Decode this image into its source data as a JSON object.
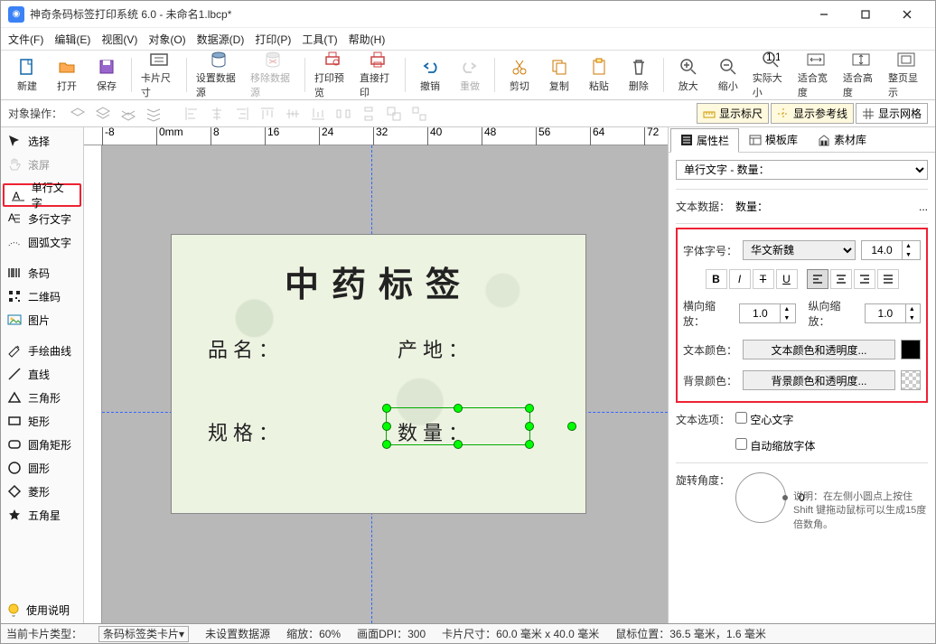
{
  "title": "神奇条码标签打印系统 6.0 - 未命名1.lbcp*",
  "menu": [
    "文件(F)",
    "编辑(E)",
    "视图(V)",
    "对象(O)",
    "数据源(D)",
    "打印(P)",
    "工具(T)",
    "帮助(H)"
  ],
  "toolbar": {
    "new": "新建",
    "open": "打开",
    "save": "保存",
    "cardsize": "卡片尺寸",
    "setds": "设置数据源",
    "remds": "移除数据源",
    "preview": "打印预览",
    "print": "直接打印",
    "undo": "撤销",
    "redo": "重做",
    "cut": "剪切",
    "copy": "复制",
    "paste": "粘贴",
    "delete": "删除",
    "zoomin": "放大",
    "zoomout": "缩小",
    "actual": "实际大小",
    "fitw": "适合宽度",
    "fith": "适合高度",
    "fitpage": "整页显示"
  },
  "objbar": {
    "label": "对象操作：",
    "ruler": "显示标尺",
    "guides": "显示参考线",
    "grid": "显示网格"
  },
  "lefttools": {
    "select": "选择",
    "pan": "滚屏",
    "singletext": "单行文字",
    "multitext": "多行文字",
    "arctext": "圆弧文字",
    "barcode": "条码",
    "qrcode": "二维码",
    "image": "图片",
    "freehand": "手绘曲线",
    "line": "直线",
    "triangle": "三角形",
    "rect": "矩形",
    "roundrect": "圆角矩形",
    "circle": "圆形",
    "diamond": "菱形",
    "star": "五角星",
    "help": "使用说明"
  },
  "canvas": {
    "title": "中药标签",
    "fields": {
      "name": "品名：",
      "origin": "产地：",
      "spec": "规格：",
      "qty": "数量："
    }
  },
  "rtabs": {
    "props": "属性栏",
    "templates": "模板库",
    "assets": "素材库"
  },
  "props": {
    "objlabel": "单行文字 - 数量：",
    "textdata_l": "文本数据：",
    "textdata_v": "数量：",
    "font_l": "字体字号：",
    "font_v": "华文新魏",
    "fontsize": "14.0",
    "sx_l": "横向缩放：",
    "sx_v": "1.0",
    "sy_l": "纵向缩放：",
    "sy_v": "1.0",
    "textcolor_l": "文本颜色：",
    "textcolor_btn": "文本颜色和透明度...",
    "bgcolor_l": "背景颜色：",
    "bgcolor_btn": "背景颜色和透明度...",
    "textopt_l": "文本选项：",
    "hollow": "空心文字",
    "autoscale": "自动缩放字体",
    "rotate_l": "旋转角度：",
    "rotate_v": "0",
    "rotate_help": "说明：在左侧小圆点上按住 Shift 键拖动鼠标可以生成15度倍数角。"
  },
  "status": {
    "cardtype_l": "当前卡片类型：",
    "cardtype_v": "条码标签类卡片",
    "ds": "未设置数据源",
    "zoom": "缩放：60%",
    "dpi": "画面DPI：300",
    "size": "卡片尺寸：60.0 毫米 x 40.0 毫米",
    "mouse": "鼠标位置：36.5 毫米，1.6 毫米"
  },
  "ruler_ticks": [
    "-8",
    "0mm",
    "8",
    "16",
    "24",
    "32",
    "40",
    "48",
    "56",
    "64",
    "72"
  ]
}
